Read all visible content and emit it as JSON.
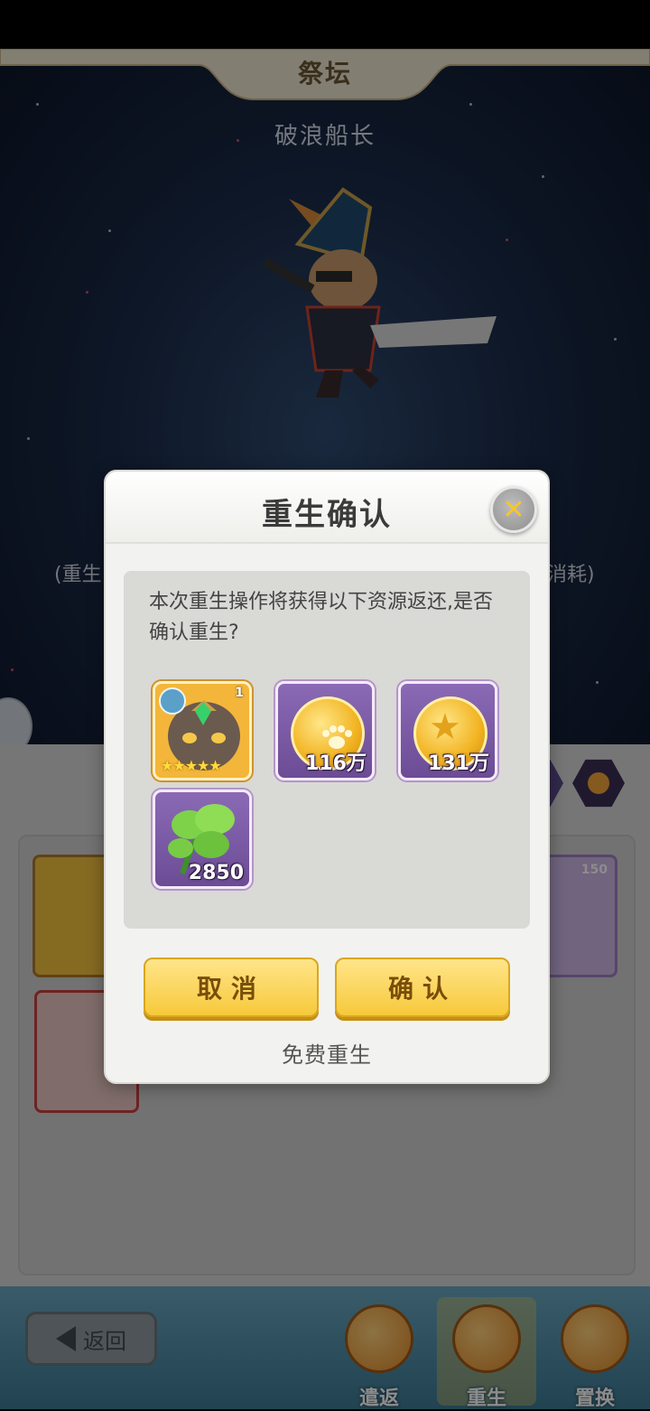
{
  "header": {
    "title": "祭坛",
    "hero_name": "破浪船长"
  },
  "side_notes": {
    "left": "(重生",
    "right": "消耗)"
  },
  "grid": {
    "cards": [
      {
        "level": "150"
      }
    ]
  },
  "bottom_nav": {
    "back_label": "返回",
    "items": [
      {
        "label": "遣返",
        "active": false
      },
      {
        "label": "重生",
        "active": true
      },
      {
        "label": "置换",
        "active": false
      }
    ]
  },
  "dialog": {
    "title": "重生确认",
    "message": "本次重生操作将获得以下资源返还,是否确认重生?",
    "rewards": [
      {
        "type": "hero",
        "icon": "hero-portrait-icon",
        "level": "1",
        "stars": "★★★★★"
      },
      {
        "type": "coin",
        "icon": "paw-coin-icon",
        "quantity": "116万"
      },
      {
        "type": "star-orb",
        "icon": "star-orb-icon",
        "quantity": "131万"
      },
      {
        "type": "herb",
        "icon": "leaf-icon",
        "quantity": "2850"
      }
    ],
    "cancel_label": "取消",
    "confirm_label": "确认",
    "free_text": "免费重生"
  },
  "colors": {
    "button_yellow": "#f7c93a",
    "dialog_bg": "#f2f2f0",
    "reward_purple": "#7b5aa6",
    "close_x": "#f5c531"
  }
}
